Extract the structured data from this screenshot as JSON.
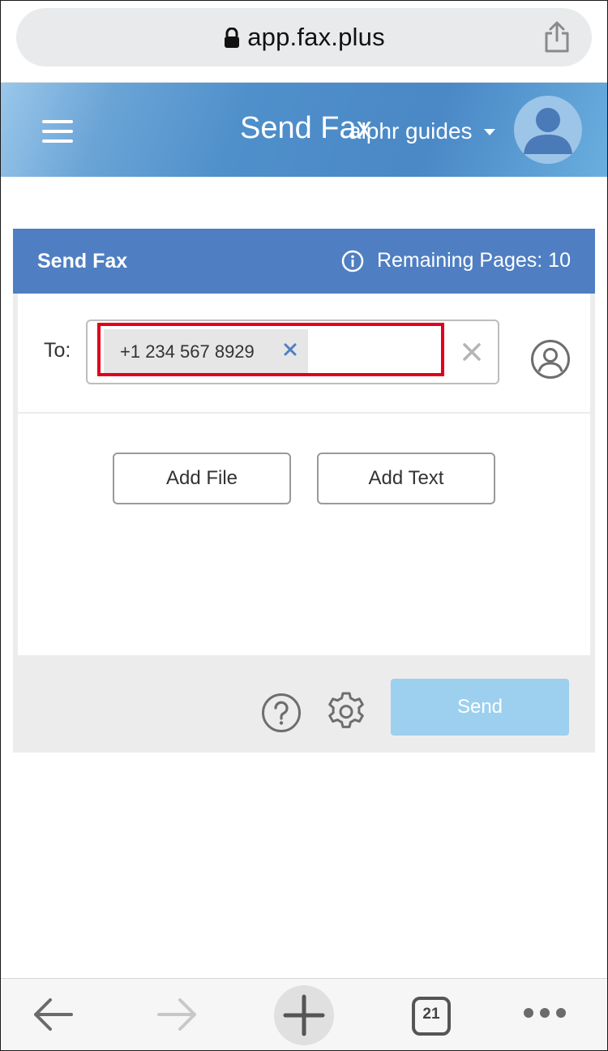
{
  "browser": {
    "url": "app.fax.plus",
    "tabs_count": "21"
  },
  "header": {
    "title": "Send Fax",
    "user_name": "alphr guides"
  },
  "card": {
    "title": "Send Fax",
    "remaining_pages": "Remaining Pages: 10",
    "to_label": "To:",
    "recipient_chip": "+1 234 567 8929",
    "add_file_label": "Add File",
    "add_text_label": "Add Text",
    "send_label": "Send"
  },
  "colors": {
    "header_blue": "#4a88c6",
    "card_header": "#4f7fc2",
    "send_disabled": "#9dcfee",
    "highlight_red": "#e0001b"
  },
  "icons": [
    "lock-icon",
    "share-icon",
    "hamburger-icon",
    "avatar-icon",
    "info-icon",
    "chip-remove-icon",
    "clear-icon",
    "contact-icon",
    "help-icon",
    "gear-icon",
    "back-icon",
    "forward-icon",
    "new-tab-icon",
    "tabs-icon",
    "more-icon"
  ]
}
